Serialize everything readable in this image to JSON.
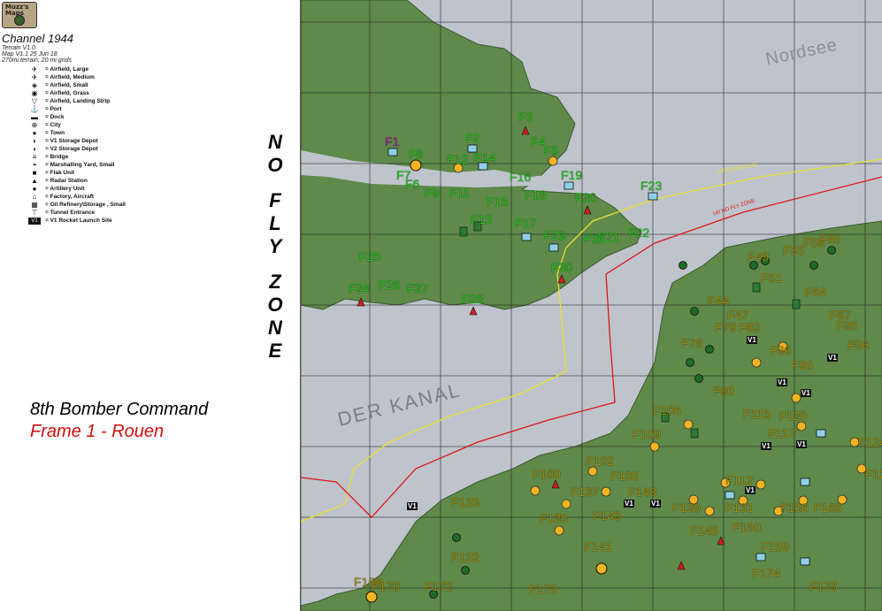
{
  "logo": {
    "text": "Muzz's Maps"
  },
  "header": {
    "title": "Channel 1944",
    "meta": [
      "Terrain V1.0",
      "Map V1.1  25 Jun 18",
      "270mi terrain, 20 mi grids"
    ]
  },
  "legend": [
    {
      "icon": "airfield-large-icon",
      "symbol": "✈",
      "label": "= Airfield, Large"
    },
    {
      "icon": "airfield-medium-icon",
      "symbol": "✈",
      "label": "= Airfield, Medium"
    },
    {
      "icon": "airfield-small-icon",
      "symbol": "◈",
      "label": "= Airfield, Small"
    },
    {
      "icon": "airfield-grass-icon",
      "symbol": "◉",
      "label": "= Airfield, Grass"
    },
    {
      "icon": "airfield-landing-strip-icon",
      "symbol": "▽",
      "label": "= Airfield, Landing Strip"
    },
    {
      "icon": "port-icon",
      "symbol": "⚓",
      "label": "= Port"
    },
    {
      "icon": "dock-icon",
      "symbol": "▬",
      "label": "= Dock"
    },
    {
      "icon": "city-icon",
      "symbol": "⊕",
      "label": "= City"
    },
    {
      "icon": "town-icon",
      "symbol": "●",
      "label": "= Town"
    },
    {
      "icon": "v1-storage-depot-icon",
      "symbol": "◗",
      "label": "= V1 Storage Depot"
    },
    {
      "icon": "v2-storage-depot-icon",
      "symbol": "◖",
      "label": "= V2 Storage Depot"
    },
    {
      "icon": "bridge-icon",
      "symbol": "≡",
      "label": "= Bridge"
    },
    {
      "icon": "marshalling-yard-icon",
      "symbol": "◓",
      "label": "= Marshalling Yard, Small"
    },
    {
      "icon": "flak-unit-icon",
      "symbol": "■",
      "label": "= Flak Unit"
    },
    {
      "icon": "radar-station-icon",
      "symbol": "▲",
      "label": "= Radar Station"
    },
    {
      "icon": "artillery-unit-icon",
      "symbol": "●",
      "label": "= Artillery Unit"
    },
    {
      "icon": "factory-aircraft-icon",
      "symbol": "⌂",
      "label": "= Factory, Aircraft"
    },
    {
      "icon": "oil-refinery-icon",
      "symbol": "▦",
      "label": "= Oil Refinery\\Storage , Small"
    },
    {
      "icon": "tunnel-entrance-icon",
      "symbol": "⊤",
      "label": "= Tunnel Entrance"
    },
    {
      "icon": "v1-rocket-launch-site-icon",
      "symbol": "V1",
      "label": "= V1 Rocket Launch Site"
    }
  ],
  "no_fly_zone": {
    "letters": [
      "N",
      "O",
      "F",
      "L",
      "Y",
      "Z",
      "O",
      "N",
      "E"
    ]
  },
  "mission": {
    "command": "8th Bomber Command",
    "frame": "Frame 1 - Rouen"
  },
  "colors": {
    "sea": "#bfc4cc",
    "land": "#5f8a4a",
    "grid": "#222222",
    "no_fly_line": "#e01515",
    "radar_line": "#e8e030",
    "allied_label": "#22c41a",
    "axis_label": "#8a7a10",
    "target_label": "#a020a0"
  },
  "map": {
    "sea_labels": {
      "north": "Nordsee",
      "channel": "DER  KANAL"
    },
    "line_labels": {
      "lw_radar_unit": "LW RADAR UNIT",
      "lw_no_fly_zone": "LW NO FLY ZONE"
    },
    "allied_labels": [
      "F1",
      "F2",
      "F3",
      "F4",
      "F5",
      "F6",
      "F7",
      "F8",
      "F9",
      "F11",
      "F12",
      "F13",
      "F14",
      "F15",
      "F16",
      "F17",
      "F18",
      "F19",
      "F20",
      "F21",
      "F22",
      "F23",
      "F24",
      "F25",
      "F26",
      "F27",
      "F28",
      "F29",
      "F30",
      "F31"
    ],
    "axis_labels": [
      "F44",
      "F47",
      "F49",
      "F51",
      "F55",
      "F58",
      "F64",
      "F65",
      "F67",
      "F78",
      "F79",
      "F80",
      "F82",
      "F86",
      "F90",
      "F95",
      "F96",
      "F100",
      "F102",
      "F103",
      "F106",
      "F109",
      "F112",
      "F115",
      "F117",
      "F120",
      "F124",
      "F128",
      "F131",
      "F132",
      "F133",
      "F135",
      "F137",
      "F139",
      "F141",
      "F143",
      "F145",
      "F148",
      "F150",
      "F156",
      "F159",
      "F165",
      "F168",
      "F170",
      "F172",
      "F173",
      "F174",
      "F175"
    ],
    "site_labels": [
      "V1",
      "V1",
      "V1",
      "V1",
      "V1",
      "V1",
      "V1",
      "V1",
      "V1",
      "V1"
    ]
  }
}
